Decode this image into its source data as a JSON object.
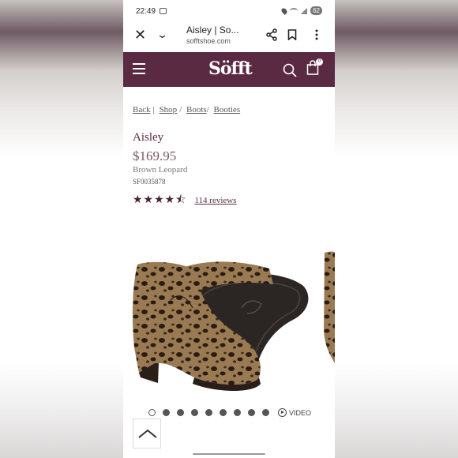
{
  "status_bar": {
    "time": "22:49",
    "battery": "62"
  },
  "browser": {
    "title": "Aisley | So...",
    "url": "sofftshoe.com"
  },
  "site": {
    "logo": "Söfft",
    "bag_count": "0",
    "brand_color": "#5a2a43"
  },
  "breadcrumb": {
    "items": [
      "Back",
      "Shop",
      "Boots",
      "Booties"
    ]
  },
  "product": {
    "name": "Aisley",
    "price": "$169.95",
    "color": "Brown Leopard",
    "sku": "SF0035878",
    "rating": 4.5,
    "stars_text": "★★★★⯪",
    "reviews": "114 reviews"
  },
  "carousel": {
    "dot_count": 9,
    "active_index": 0,
    "video_label": "VIDEO"
  },
  "icons": [
    "close-icon",
    "chevron-down-icon",
    "share-icon",
    "bookmark-icon",
    "kebab-menu-icon",
    "hamburger-menu-icon",
    "search-icon",
    "shopping-bag-icon",
    "play-icon",
    "chevron-up-icon"
  ]
}
